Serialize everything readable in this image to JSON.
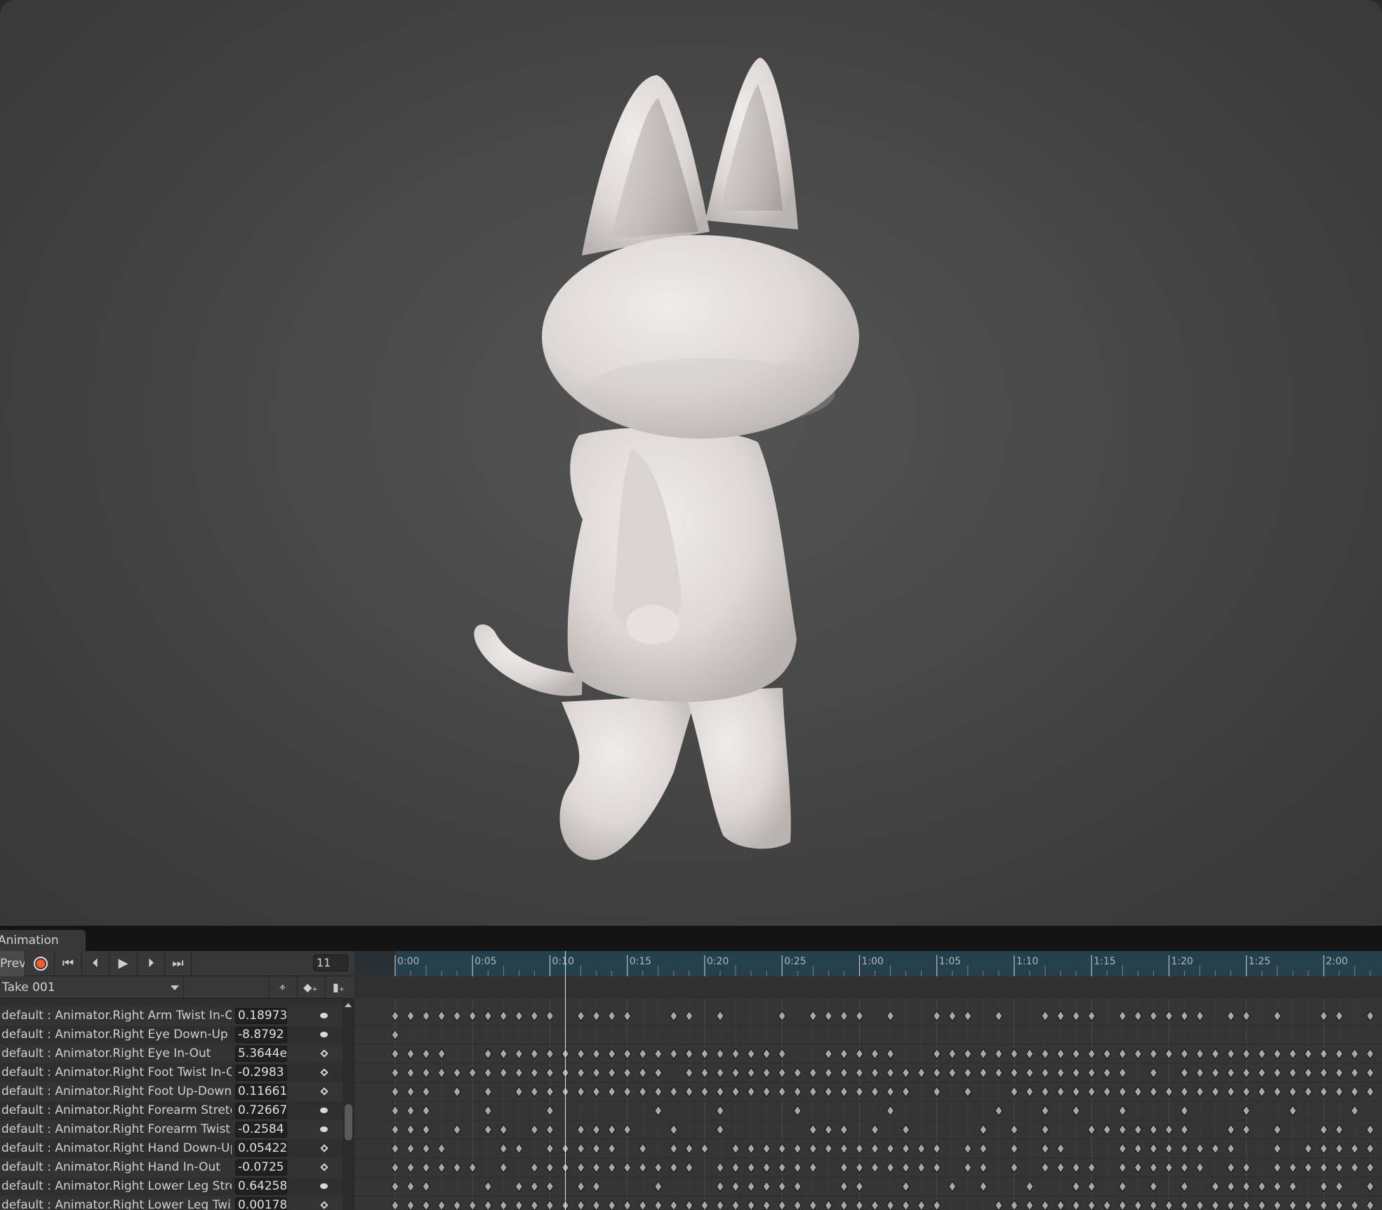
{
  "panel": {
    "tab_label": "Animation",
    "preview_label": "Preview",
    "record_color": "#ff5a2a",
    "frame": "11",
    "clip_name": "Take 001",
    "controls": [
      "record-icon",
      "first-key-icon",
      "prev-key-icon",
      "play-icon",
      "next-key-icon",
      "last-key-icon"
    ],
    "tools": [
      "filter-by-selection-icon",
      "add-keyframe-icon",
      "add-event-icon"
    ]
  },
  "timeline": {
    "ruler_labels": [
      "0:00",
      "0:05",
      "0:10",
      "0:15",
      "0:20",
      "0:25",
      "1:00",
      "1:05",
      "1:10",
      "1:15",
      "1:20",
      "1:25",
      "2:00"
    ],
    "playhead_frame": 11,
    "ruler_color": "#263f4c"
  },
  "properties": [
    {
      "name": "default : Animator.Right Arm Twist In-Out",
      "value": "0.18973",
      "key": "ellipse",
      "keys": [
        0,
        1,
        2,
        3,
        4,
        5,
        6,
        7,
        8,
        9,
        10,
        12,
        13,
        14,
        15,
        18,
        19,
        21,
        25,
        27,
        28,
        29,
        30,
        32,
        35,
        36,
        37,
        39,
        42,
        43,
        44,
        45,
        47,
        48,
        49,
        50,
        51,
        52,
        54,
        55,
        57,
        60,
        61,
        63
      ]
    },
    {
      "name": "default : Animator.Right Eye Down-Up",
      "value": "-8.8792",
      "key": "ellipse",
      "keys": [
        0
      ]
    },
    {
      "name": "default : Animator.Right Eye In-Out",
      "value": "5.3644e",
      "key": "diamond",
      "keys": [
        0,
        1,
        2,
        3,
        6,
        7,
        8,
        9,
        10,
        11,
        12,
        13,
        14,
        15,
        16,
        17,
        18,
        19,
        20,
        21,
        22,
        23,
        24,
        25,
        28,
        29,
        30,
        31,
        32,
        35,
        36,
        37,
        38,
        39,
        40,
        41,
        42,
        43,
        44,
        45,
        46,
        47,
        48,
        49,
        50,
        51,
        52,
        53,
        54,
        55,
        56,
        57,
        58,
        59,
        60,
        61,
        62,
        63
      ]
    },
    {
      "name": "default : Animator.Right Foot Twist In-Out",
      "value": "-0.2983",
      "key": "diamond",
      "keys": [
        0,
        1,
        2,
        3,
        4,
        5,
        6,
        7,
        8,
        9,
        10,
        11,
        12,
        13,
        14,
        15,
        16,
        17,
        19,
        20,
        21,
        22,
        23,
        24,
        25,
        26,
        27,
        28,
        29,
        30,
        31,
        32,
        33,
        34,
        35,
        36,
        37,
        38,
        39,
        40,
        41,
        42,
        43,
        44,
        45,
        46,
        47,
        49,
        51,
        52,
        53,
        54,
        55,
        56,
        57,
        58,
        59,
        60,
        61,
        62,
        63
      ]
    },
    {
      "name": "default : Animator.Right Foot Up-Down",
      "value": "0.11661",
      "key": "diamond",
      "keys": [
        0,
        1,
        2,
        4,
        6,
        8,
        9,
        10,
        11,
        12,
        13,
        14,
        15,
        16,
        17,
        18,
        19,
        20,
        21,
        22,
        23,
        24,
        25,
        26,
        27,
        28,
        29,
        30,
        31,
        32,
        33,
        35,
        37,
        40,
        41,
        42,
        43,
        44,
        45,
        46,
        47,
        48,
        49,
        50,
        51,
        52,
        53,
        54,
        55,
        56,
        57,
        58,
        59,
        60,
        61,
        62,
        63
      ]
    },
    {
      "name": "default : Animator.Right Forearm Stretch",
      "value": "0.72667",
      "key": "ellipse",
      "keys": [
        0,
        1,
        2,
        6,
        10,
        17,
        21,
        26,
        32,
        39,
        42,
        44,
        47,
        51,
        55,
        58,
        62
      ]
    },
    {
      "name": "default : Animator.Right Forearm Twist In-Out",
      "value": "-0.2584",
      "key": "ellipse",
      "keys": [
        0,
        1,
        2,
        4,
        6,
        7,
        9,
        10,
        12,
        13,
        14,
        15,
        18,
        21,
        27,
        28,
        29,
        31,
        33,
        38,
        40,
        42,
        45,
        46,
        47,
        48,
        49,
        50,
        51,
        54,
        55,
        57,
        60,
        61,
        63
      ]
    },
    {
      "name": "default : Animator.Right Hand Down-Up",
      "value": "0.05422",
      "key": "diamond",
      "keys": [
        0,
        1,
        2,
        3,
        7,
        8,
        10,
        11,
        12,
        13,
        14,
        16,
        18,
        19,
        20,
        22,
        23,
        24,
        25,
        26,
        27,
        28,
        29,
        30,
        31,
        32,
        33,
        34,
        35,
        37,
        38,
        40,
        42,
        43,
        47,
        48,
        49,
        50,
        51,
        52,
        53,
        54,
        57,
        59,
        60,
        61,
        62,
        63
      ]
    },
    {
      "name": "default : Animator.Right Hand In-Out",
      "value": "-0.0725",
      "key": "diamond",
      "keys": [
        0,
        1,
        2,
        3,
        4,
        5,
        7,
        9,
        10,
        11,
        12,
        13,
        14,
        15,
        16,
        17,
        18,
        19,
        21,
        22,
        23,
        24,
        25,
        26,
        27,
        29,
        30,
        31,
        32,
        33,
        34,
        35,
        37,
        38,
        40,
        42,
        43,
        44,
        45,
        47,
        48,
        49,
        50,
        51,
        52,
        54,
        55,
        57,
        58,
        59,
        60,
        61,
        62,
        63
      ]
    },
    {
      "name": "default : Animator.Right Lower Leg Stretch",
      "value": "0.64258",
      "key": "ellipse",
      "keys": [
        0,
        1,
        2,
        6,
        8,
        9,
        10,
        12,
        13,
        17,
        21,
        22,
        23,
        24,
        25,
        26,
        29,
        30,
        33,
        36,
        38,
        41,
        44,
        45,
        47,
        49,
        51,
        53,
        54,
        55,
        56,
        57,
        58,
        60,
        61,
        63
      ]
    },
    {
      "name": "default : Animator.Right Lower Leg Twist In-Out",
      "value": "0.00178",
      "key": "diamond",
      "keys": [
        0,
        1,
        2,
        3,
        4,
        5,
        6,
        7,
        8,
        9,
        10,
        11,
        12,
        13,
        14,
        15,
        16,
        17,
        18,
        19,
        20,
        21,
        22,
        23,
        24,
        25,
        26,
        27,
        28,
        29,
        30,
        31,
        32,
        33,
        34,
        35,
        39,
        40,
        41,
        42,
        43,
        44,
        45,
        46,
        47,
        48,
        49,
        50,
        51,
        52,
        53,
        54,
        55,
        56,
        57,
        58,
        59,
        60,
        61,
        62,
        63
      ]
    }
  ]
}
